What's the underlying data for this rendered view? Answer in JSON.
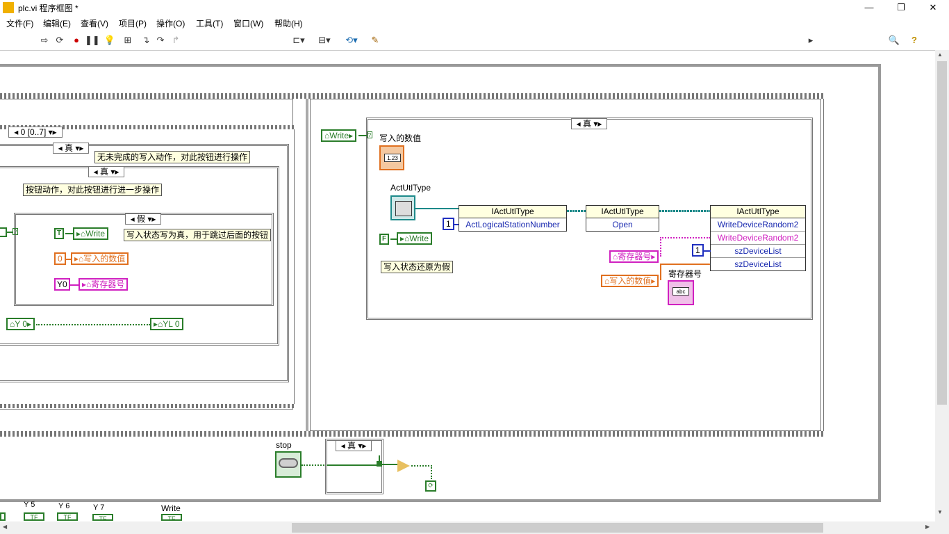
{
  "window": {
    "title": "plc.vi 程序框图 *",
    "minimize": "—",
    "maximize": "❐",
    "close": "✕"
  },
  "menu": [
    "文件(F)",
    "编辑(E)",
    "查看(V)",
    "项目(P)",
    "操作(O)",
    "工具(T)",
    "窗口(W)",
    "帮助(H)"
  ],
  "toolbar": {
    "font": "17pt 应用程序字体",
    "search_placeholder": "搜索"
  },
  "diagram": {
    "seq_selector": "0 [0..7]",
    "case_true_1": "真",
    "case_true_2": "真",
    "case_false": "假",
    "case_true_right": "真",
    "case_true_bottom": "真",
    "comment_1": "无未完成的写入动作，对此按钮进行操作",
    "comment_2": "按钮动作，对此按钮进行进一步操作",
    "comment_3": "写入状态写为真，用于跳过后面的按钮",
    "comment_4": "写入状态还原为假",
    "const_T": "T",
    "const_F": "F",
    "local_write_1": "Write",
    "local_write_2": "Write",
    "local_write_3": "Write",
    "const_zero": "0",
    "local_value_1": "写入的数值",
    "local_value_2": "写入的数值",
    "const_y0": "Y0",
    "local_reg_1": "寄存器号",
    "local_reg_2": "寄存器号",
    "local_y0": "Y 0",
    "local_yl0": "YL 0",
    "label_value": "写入的数值",
    "label_actutl": "ActUtlType",
    "label_reg": "寄存器号",
    "label_stop": "stop",
    "const_one_1": "1",
    "const_one_2": "1",
    "node1": {
      "head": "IActUtlType",
      "row": "ActLogicalStationNumber"
    },
    "node2": {
      "head": "IActUtlType",
      "row": "Open"
    },
    "node3": {
      "head": "IActUtlType",
      "rows": [
        "WriteDeviceRandom2",
        "WriteDeviceRandom2",
        "szDeviceList",
        "szDeviceList"
      ]
    },
    "bottom_labels": [
      "Y 5",
      "Y 6",
      "Y 7",
      "Write"
    ],
    "ind_num": "1.23",
    "ind_abc": "abc"
  }
}
